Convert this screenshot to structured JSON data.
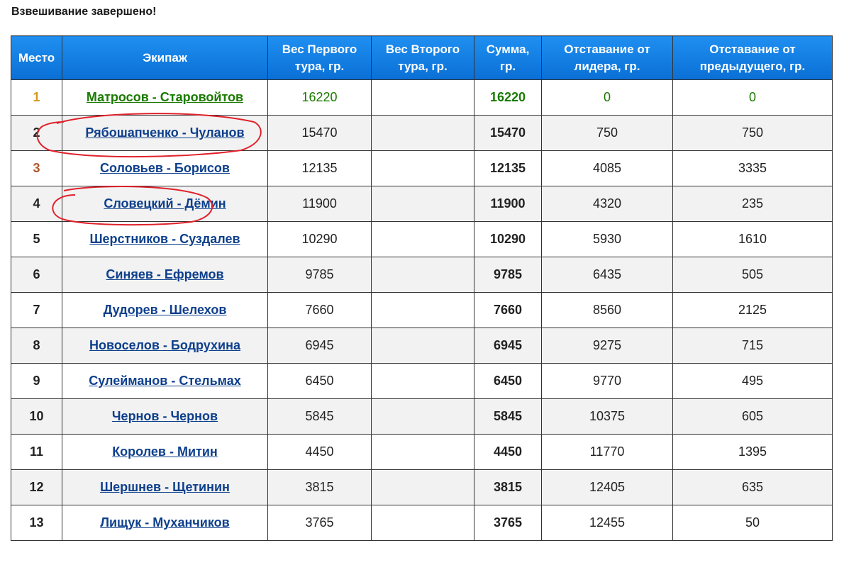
{
  "heading": "Взвешивание завершено!",
  "columns": [
    "Место",
    "Экипаж",
    "Вес Первого тура, гр.",
    "Вес Второго тура, гр.",
    "Сумма, гр.",
    "Отставание от лидера, гр.",
    "Отставание от предыдущего, гр."
  ],
  "rows": [
    {
      "place": "1",
      "crew": "Матросов - Старовойтов",
      "w1": "16220",
      "w2": "",
      "sum": "16220",
      "gap_leader": "0",
      "gap_prev": "0"
    },
    {
      "place": "2",
      "crew": "Рябошапченко - Чуланов",
      "w1": "15470",
      "w2": "",
      "sum": "15470",
      "gap_leader": "750",
      "gap_prev": "750"
    },
    {
      "place": "3",
      "crew": "Соловьев - Борисов",
      "w1": "12135",
      "w2": "",
      "sum": "12135",
      "gap_leader": "4085",
      "gap_prev": "3335"
    },
    {
      "place": "4",
      "crew": "Словецкий - Дёмин",
      "w1": "11900",
      "w2": "",
      "sum": "11900",
      "gap_leader": "4320",
      "gap_prev": "235"
    },
    {
      "place": "5",
      "crew": "Шерстников - Суздалев",
      "w1": "10290",
      "w2": "",
      "sum": "10290",
      "gap_leader": "5930",
      "gap_prev": "1610"
    },
    {
      "place": "6",
      "crew": "Синяев - Ефремов",
      "w1": "9785",
      "w2": "",
      "sum": "9785",
      "gap_leader": "6435",
      "gap_prev": "505"
    },
    {
      "place": "7",
      "crew": "Дудорев - Шелехов",
      "w1": "7660",
      "w2": "",
      "sum": "7660",
      "gap_leader": "8560",
      "gap_prev": "2125"
    },
    {
      "place": "8",
      "crew": "Новоселов - Бодрухина",
      "w1": "6945",
      "w2": "",
      "sum": "6945",
      "gap_leader": "9275",
      "gap_prev": "715"
    },
    {
      "place": "9",
      "crew": "Сулейманов - Стельмах",
      "w1": "6450",
      "w2": "",
      "sum": "6450",
      "gap_leader": "9770",
      "gap_prev": "495"
    },
    {
      "place": "10",
      "crew": "Чернов - Чернов",
      "w1": "5845",
      "w2": "",
      "sum": "5845",
      "gap_leader": "10375",
      "gap_prev": "605"
    },
    {
      "place": "11",
      "crew": "Королев - Митин",
      "w1": "4450",
      "w2": "",
      "sum": "4450",
      "gap_leader": "11770",
      "gap_prev": "1395"
    },
    {
      "place": "12",
      "crew": "Шершнев - Щетинин",
      "w1": "3815",
      "w2": "",
      "sum": "3815",
      "gap_leader": "12405",
      "gap_prev": "635"
    },
    {
      "place": "13",
      "crew": "Лищук - Муханчиков",
      "w1": "3765",
      "w2": "",
      "sum": "3765",
      "gap_leader": "12455",
      "gap_prev": "50"
    }
  ],
  "colors": {
    "header_blue": "#0a6fd6",
    "link_blue": "#0d3f8c",
    "leader_green": "#1a7a00",
    "gold": "#d39a1c",
    "bronze": "#b0552b",
    "annotation_red": "#e0212b"
  }
}
